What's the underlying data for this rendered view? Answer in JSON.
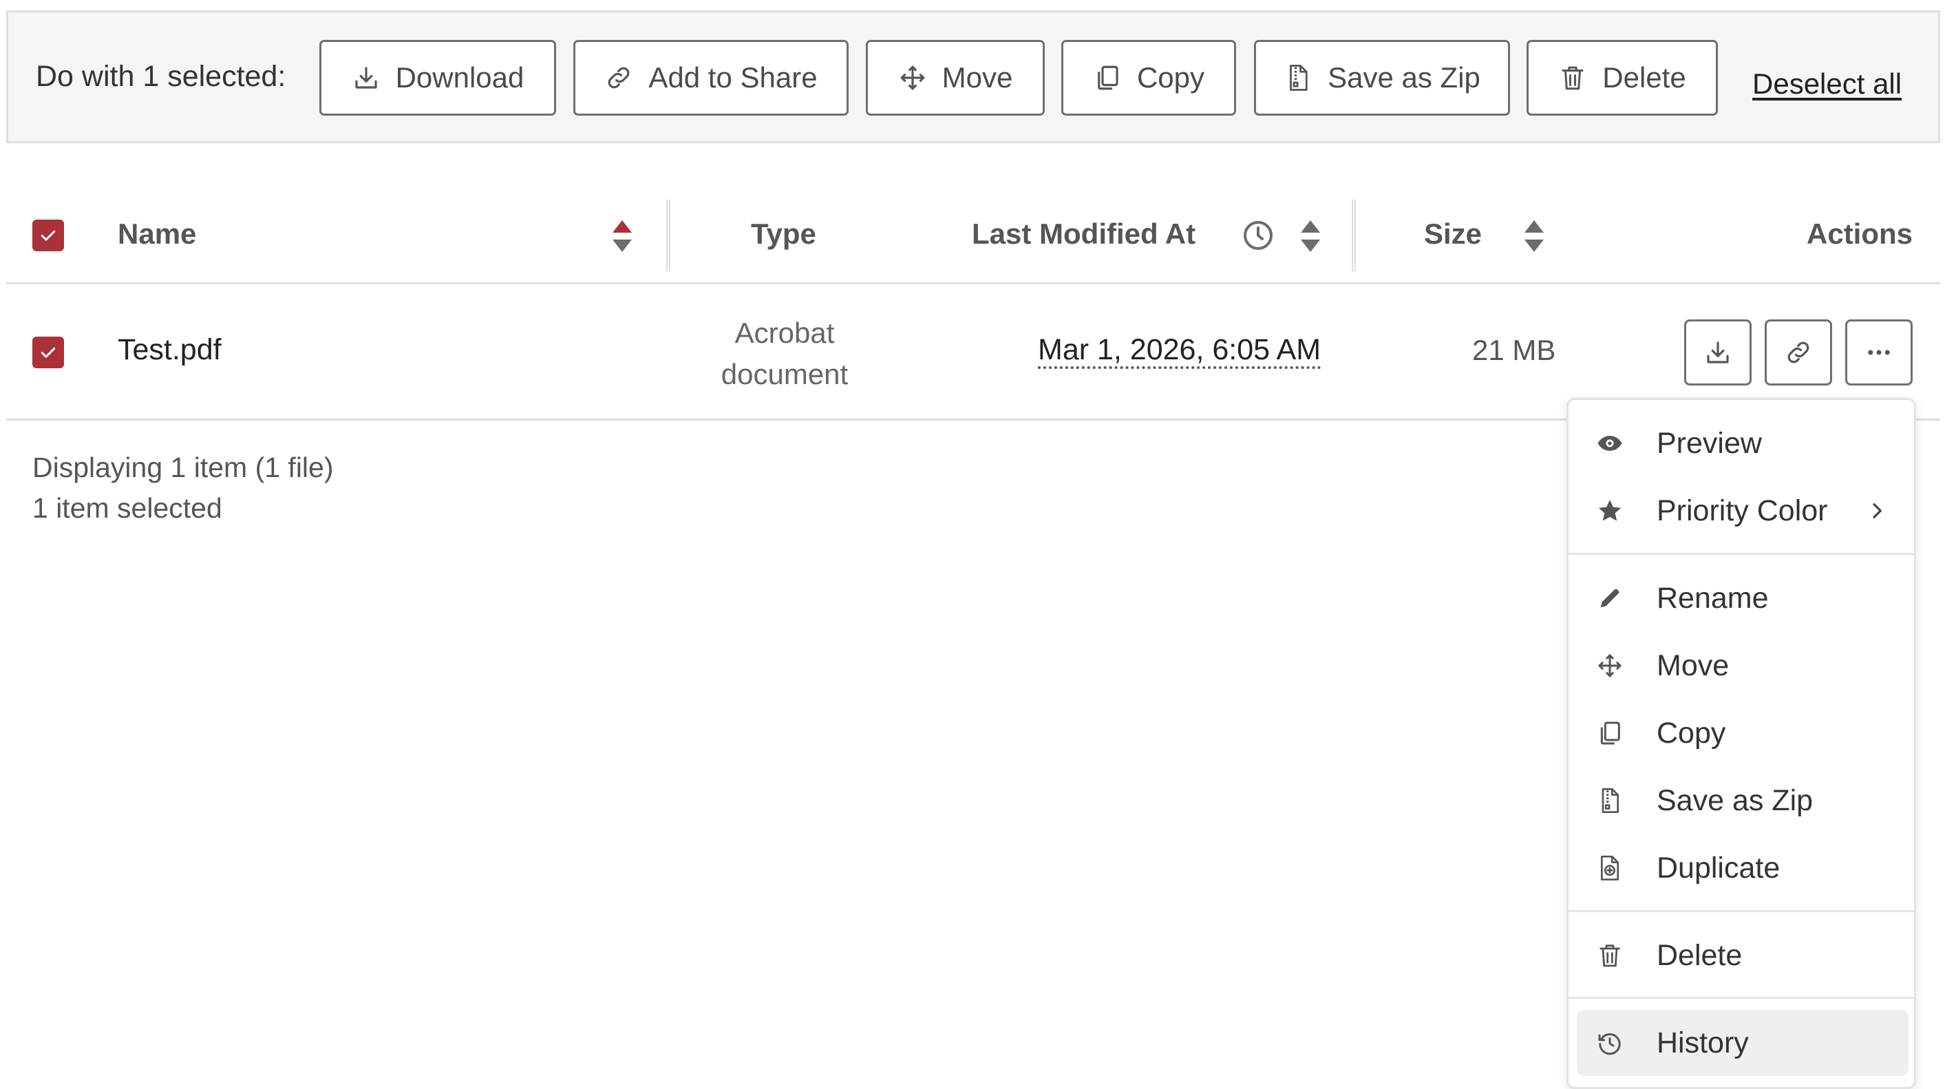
{
  "toolbar": {
    "label": "Do with 1 selected:",
    "buttons": {
      "download": "Download",
      "add_to_share": "Add to Share",
      "move": "Move",
      "copy": "Copy",
      "save_as_zip": "Save as Zip",
      "delete": "Delete"
    },
    "deselect_all": "Deselect all"
  },
  "table": {
    "columns": {
      "name": "Name",
      "type": "Type",
      "last_modified": "Last Modified At",
      "size": "Size",
      "actions": "Actions"
    },
    "rows": [
      {
        "selected": true,
        "name": "Test.pdf",
        "type_line1": "Acrobat",
        "type_line2": "document",
        "modified": "Mar 1, 2026, 6:05 AM",
        "size": "21 MB"
      }
    ],
    "header_checkbox_checked": true
  },
  "footer": {
    "display_count": "Displaying 1 item (1 file)",
    "selected_count": "1 item selected"
  },
  "menu": {
    "items": {
      "preview": "Preview",
      "priority_color": "Priority Color",
      "rename": "Rename",
      "move": "Move",
      "copy": "Copy",
      "save_as_zip": "Save as Zip",
      "duplicate": "Duplicate",
      "delete": "Delete",
      "history": "History"
    },
    "hovered_item": "history"
  },
  "colors": {
    "accent": "#a83238",
    "border": "#6f6f6f",
    "toolbar_bg": "#f5f5f5",
    "menu_hover": "#efefef"
  }
}
